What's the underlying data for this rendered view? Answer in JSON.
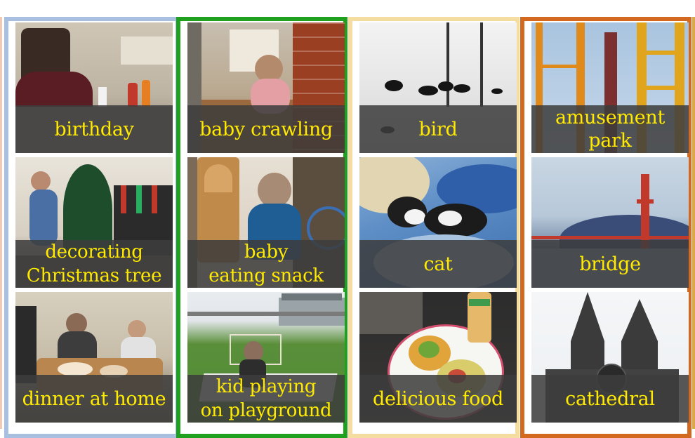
{
  "columns": [
    {
      "border_color": "#a9bfdf",
      "tiles": [
        {
          "label": "birthday",
          "scene": "birthday-party"
        },
        {
          "label": "decorating\nChristmas tree",
          "scene": "christmas-tree"
        },
        {
          "label": "dinner at home",
          "scene": "family-dinner"
        }
      ]
    },
    {
      "border_color": "#1fa11f",
      "tiles": [
        {
          "label": "baby crawling",
          "scene": "hallway-baby"
        },
        {
          "label": "baby\neating snack",
          "scene": "doorway-baby"
        },
        {
          "label": "kid playing\non playground",
          "scene": "playground"
        }
      ]
    },
    {
      "border_color": "#f5dca0",
      "tiles": [
        {
          "label": "bird",
          "scene": "birds-in-snow"
        },
        {
          "label": "cat",
          "scene": "cat-on-blanket"
        },
        {
          "label": "delicious food",
          "scene": "food-plate"
        }
      ]
    },
    {
      "border_color": "#d2691e",
      "tiles": [
        {
          "label": "amusement park",
          "scene": "roller-coaster"
        },
        {
          "label": "bridge",
          "scene": "golden-gate"
        },
        {
          "label": "cathedral",
          "scene": "gothic-cathedral"
        }
      ]
    }
  ]
}
